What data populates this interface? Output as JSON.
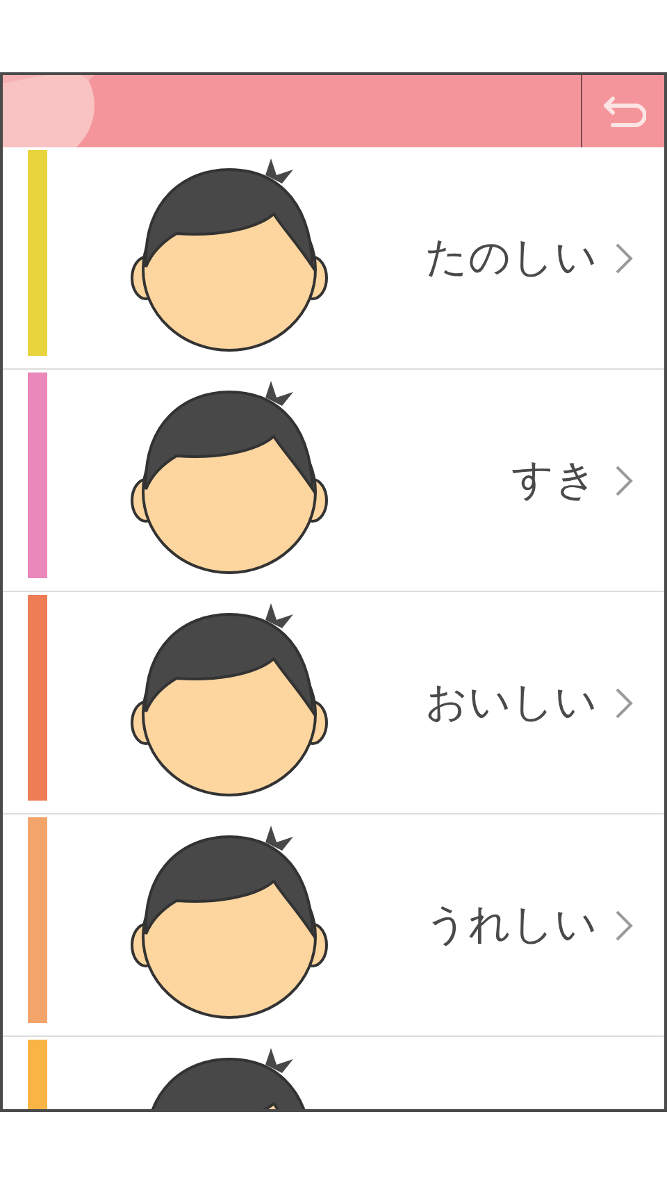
{
  "items": [
    {
      "label": "たのしい",
      "color": "#e8d43c"
    },
    {
      "label": "すき",
      "color": "#ea87bb"
    },
    {
      "label": "おいしい",
      "color": "#ee7d56"
    },
    {
      "label": "うれしい",
      "color": "#f3a46a"
    },
    {
      "color": "#f8b445"
    }
  ]
}
